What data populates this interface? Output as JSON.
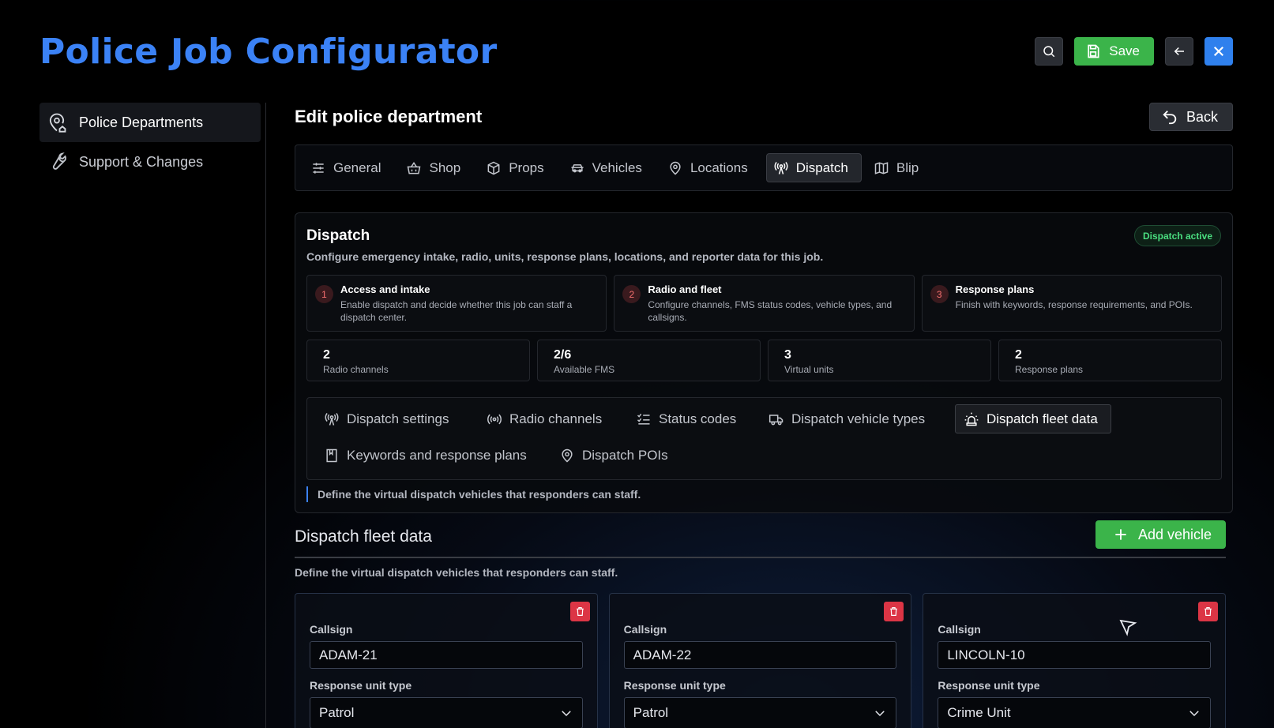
{
  "app": {
    "title": "Police Job Configurator"
  },
  "header": {
    "save_label": "Save"
  },
  "sidebar": {
    "items": [
      {
        "label": "Police Departments",
        "icon": "map-pin-house-icon"
      },
      {
        "label": "Support & Changes",
        "icon": "wrench-icon"
      }
    ]
  },
  "main": {
    "title": "Edit police department",
    "back_label": "Back",
    "tabs": [
      {
        "label": "General",
        "icon": "sliders-icon"
      },
      {
        "label": "Shop",
        "icon": "basket-icon"
      },
      {
        "label": "Props",
        "icon": "box-icon"
      },
      {
        "label": "Vehicles",
        "icon": "car-icon"
      },
      {
        "label": "Locations",
        "icon": "map-pin-icon"
      },
      {
        "label": "Dispatch",
        "icon": "radio-tower-icon"
      },
      {
        "label": "Blip",
        "icon": "map-icon"
      }
    ]
  },
  "dispatch": {
    "title": "Dispatch",
    "subtitle": "Configure emergency intake, radio, units, response plans, locations, and reporter data for this job.",
    "status_badge": "Dispatch active",
    "steps": [
      {
        "num": "1",
        "title": "Access and intake",
        "desc": "Enable dispatch and decide whether this job can staff a dispatch center."
      },
      {
        "num": "2",
        "title": "Radio and fleet",
        "desc": "Configure channels, FMS status codes, vehicle types, and callsigns."
      },
      {
        "num": "3",
        "title": "Response plans",
        "desc": "Finish with keywords, response requirements, and POIs."
      }
    ],
    "stats": [
      {
        "value": "2",
        "label": "Radio channels"
      },
      {
        "value": "2/6",
        "label": "Available FMS"
      },
      {
        "value": "3",
        "label": "Virtual units"
      },
      {
        "value": "2",
        "label": "Response plans"
      }
    ],
    "subtabs": [
      {
        "label": "Dispatch settings",
        "icon": "radio-tower-icon"
      },
      {
        "label": "Radio channels",
        "icon": "radio-icon"
      },
      {
        "label": "Status codes",
        "icon": "list-checks-icon"
      },
      {
        "label": "Dispatch vehicle types",
        "icon": "truck-icon"
      },
      {
        "label": "Dispatch fleet data",
        "icon": "siren-icon"
      },
      {
        "label": "Keywords and response plans",
        "icon": "book-icon"
      },
      {
        "label": "Dispatch POIs",
        "icon": "map-pin-icon"
      }
    ],
    "hint": "Define the virtual dispatch vehicles that responders can staff."
  },
  "fleet": {
    "title": "Dispatch fleet data",
    "add_label": "Add vehicle",
    "description": "Define the virtual dispatch vehicles that responders can staff.",
    "callsign_label": "Callsign",
    "unit_type_label": "Response unit type",
    "vehicles": [
      {
        "callsign": "ADAM-21",
        "unit_type": "Patrol"
      },
      {
        "callsign": "ADAM-22",
        "unit_type": "Patrol"
      },
      {
        "callsign": "LINCOLN-10",
        "unit_type": "Crime Unit"
      }
    ]
  },
  "colors": {
    "accent": "#3b82f6",
    "save": "#3bb44a",
    "danger": "#dc3545",
    "active_badge": "#4ade80"
  }
}
